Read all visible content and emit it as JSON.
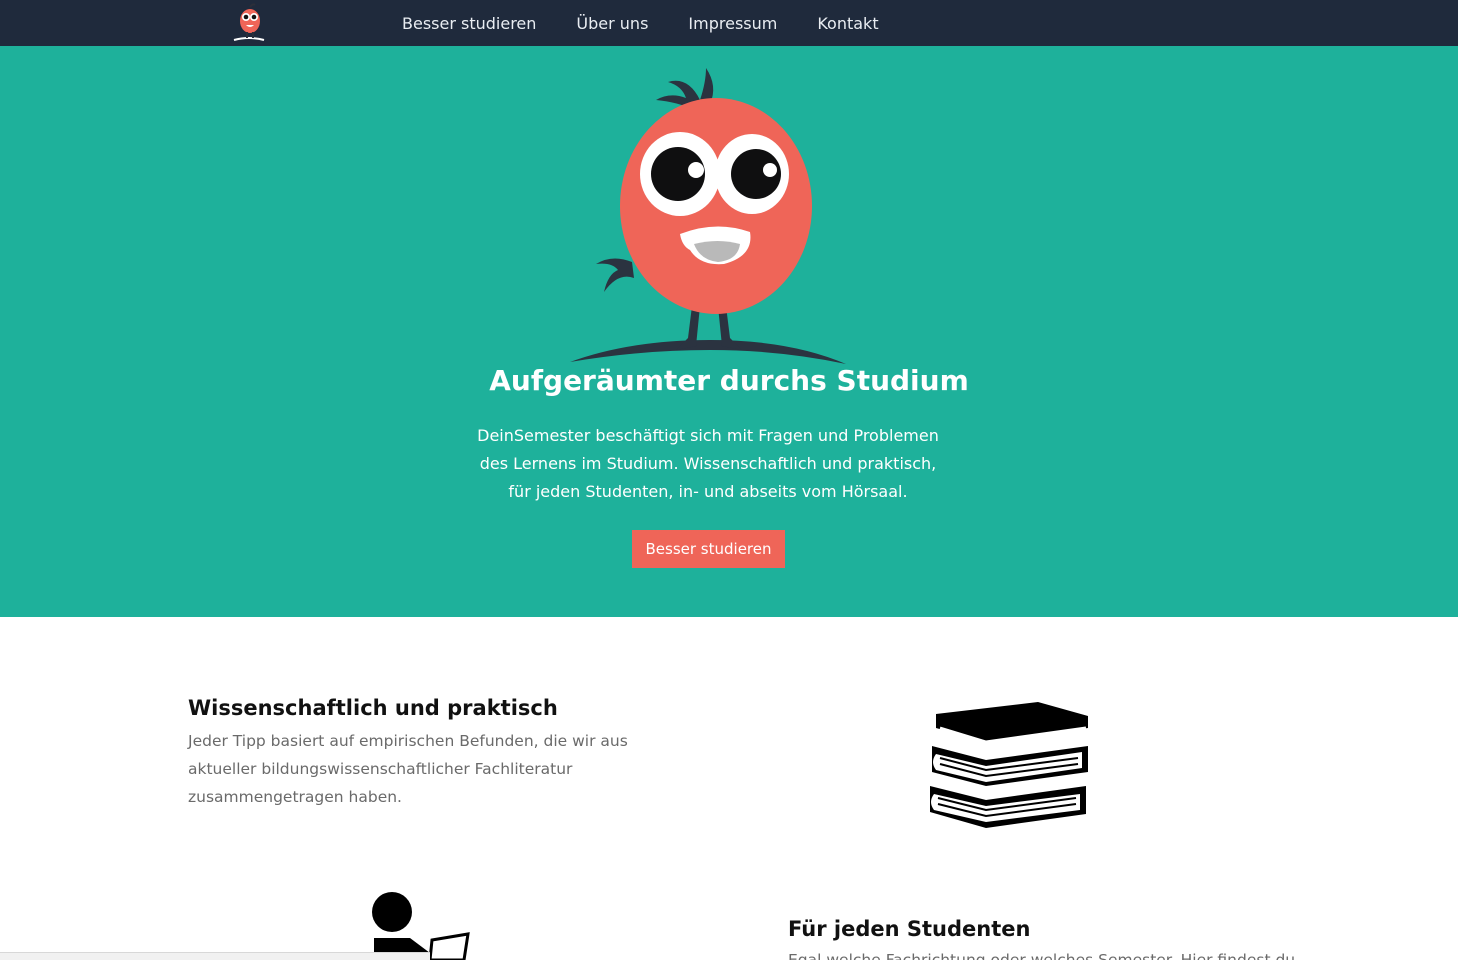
{
  "nav": {
    "logo_icon": "mascot-logo-icon",
    "links": [
      {
        "label": "Besser studieren"
      },
      {
        "label": "Über uns"
      },
      {
        "label": "Impressum"
      },
      {
        "label": "Kontakt"
      }
    ]
  },
  "hero": {
    "mascot_icon": "tomato-mascot-icon",
    "title": "Aufgeräumter durchs Studium",
    "text": "DeinSemester beschäftigt sich mit Fragen und Problemen des Lernens im Studium. Wissenschaftlich und praktisch, für jeden Studenten, in- und abseits vom Hörsaal.",
    "button_label": "Besser studieren"
  },
  "features": [
    {
      "title": "Wissenschaftlich und praktisch",
      "text": "Jeder Tipp basiert auf empirischen Befunden, die wir aus aktueller bildungswissenschaftlicher Fachliteratur zusammengetragen haben.",
      "icon": "books-icon"
    },
    {
      "title": "Für jeden Studenten",
      "text": "Egal welche Fachrichtung oder welches Semester. Hier findest du",
      "icon": "reading-person-icon"
    }
  ],
  "colors": {
    "navbar": "#1f2a3c",
    "hero": "#1eb19b",
    "accent": "#ef6558"
  }
}
